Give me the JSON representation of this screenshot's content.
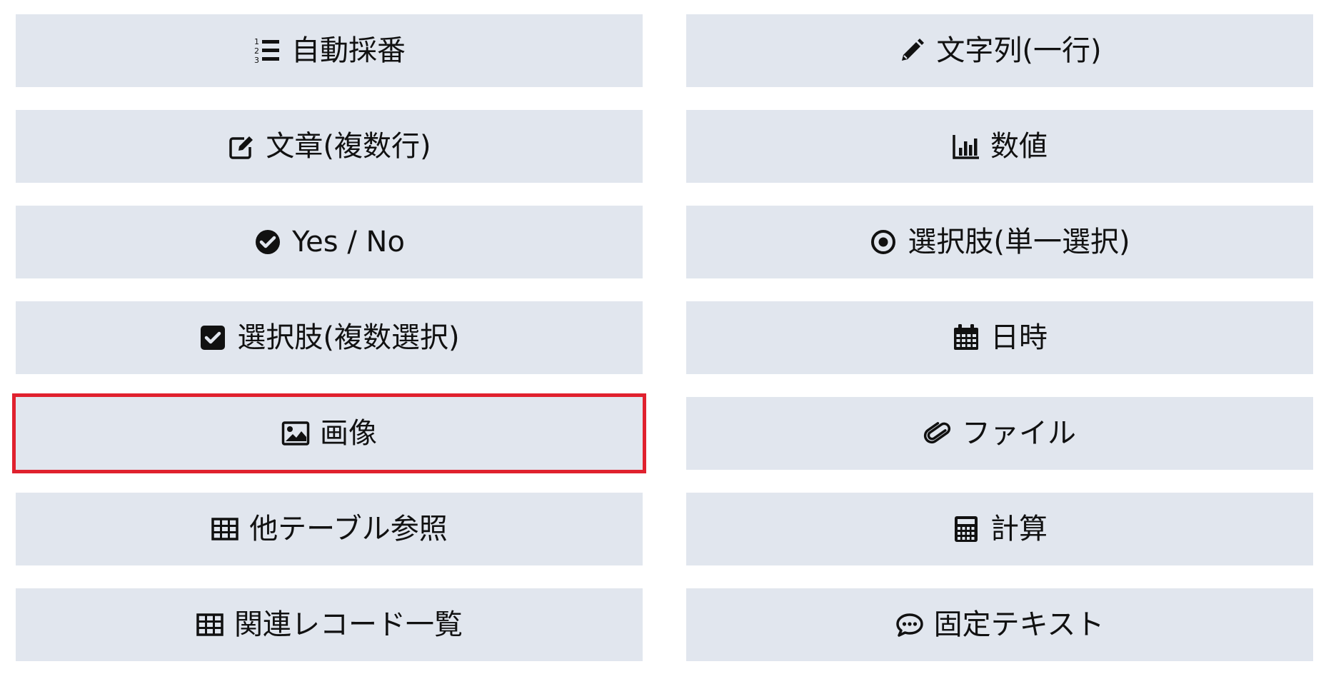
{
  "accent": {
    "button_bg": "#e1e6ee",
    "selected_border": "#e0212e",
    "text": "#111111"
  },
  "buttons": {
    "auto_number": {
      "label": "自動採番",
      "icon": "ordered-list-icon"
    },
    "single_line_text": {
      "label": "文字列(一行)",
      "icon": "pencil-icon"
    },
    "multi_line_text": {
      "label": "文章(複数行)",
      "icon": "edit-square-icon"
    },
    "number": {
      "label": "数値",
      "icon": "bar-chart-icon"
    },
    "yes_no": {
      "label": "Yes / No",
      "icon": "check-circle-icon"
    },
    "single_select": {
      "label": "選択肢(単一選択)",
      "icon": "radio-dot-icon"
    },
    "multi_select": {
      "label": "選択肢(複数選択)",
      "icon": "check-square-icon"
    },
    "datetime": {
      "label": "日時",
      "icon": "calendar-icon"
    },
    "image": {
      "label": "画像",
      "icon": "image-icon",
      "selected": true
    },
    "file": {
      "label": "ファイル",
      "icon": "paperclip-icon"
    },
    "table_reference": {
      "label": "他テーブル参照",
      "icon": "table-icon"
    },
    "calculation": {
      "label": "計算",
      "icon": "calculator-icon"
    },
    "related_records": {
      "label": "関連レコード一覧",
      "icon": "table-icon"
    },
    "fixed_text": {
      "label": "固定テキスト",
      "icon": "comment-icon"
    }
  }
}
